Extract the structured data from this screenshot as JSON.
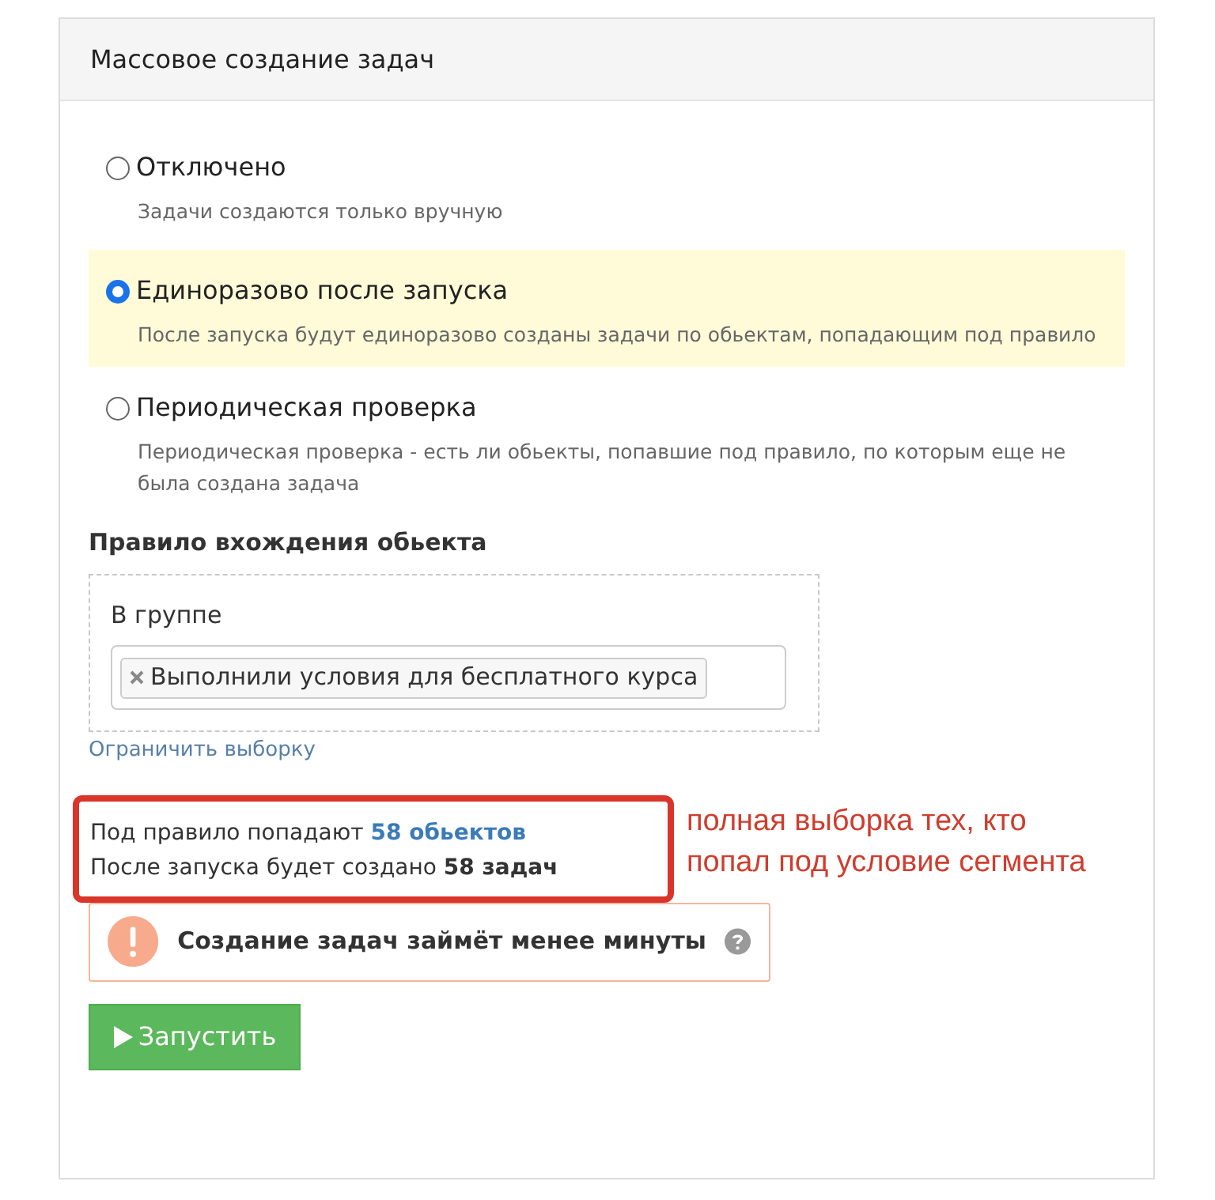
{
  "panel": {
    "title": "Массовое создание задач"
  },
  "modes": [
    {
      "label": "Отключено",
      "description": "Задачи создаются только вручную",
      "selected": false
    },
    {
      "label": "Единоразово после запуска",
      "description": "После запуска будут единоразово созданы задачи по обьектам, попадающим под правило",
      "selected": true
    },
    {
      "label": "Периодическая проверка",
      "description": "Периодическая проверка - есть ли обьекты, попавшие под правило, по которым еще не была создана задача",
      "selected": false
    }
  ],
  "rule": {
    "title": "Правило вхождения обьекта",
    "group_label": "В группе",
    "tags": [
      "Выполнили условия для бесплатного курса"
    ],
    "limit_link": "Ограничить выборку"
  },
  "summary": {
    "objects_prefix": "Под правило попадают",
    "objects_count": "58 обьектов",
    "tasks_prefix": "После запуска будет создано",
    "tasks_count": "58 задач"
  },
  "annotation": [
    "полная выборка тех, кто",
    "попал под условие сегмента"
  ],
  "notice": {
    "text": "Создание задач займёт менее минуты"
  },
  "run_button": "Запустить"
}
